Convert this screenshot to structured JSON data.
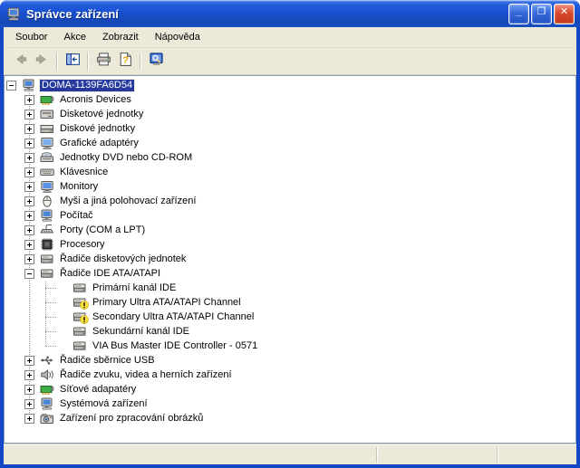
{
  "window": {
    "title": "Správce zařízení",
    "icon": "device-manager-computer-icon",
    "controls": [
      {
        "name": "minimize",
        "glyph": "_"
      },
      {
        "name": "maximize",
        "glyph": "❐"
      },
      {
        "name": "close",
        "glyph": "✕"
      }
    ]
  },
  "menu_bar": {
    "items": [
      {
        "label": "Soubor"
      },
      {
        "label": "Akce"
      },
      {
        "label": "Zobrazit"
      },
      {
        "label": "Nápověda"
      }
    ]
  },
  "toolbar": {
    "buttons": [
      {
        "name": "back",
        "icon": "arrow-left-icon",
        "disabled": true
      },
      {
        "name": "forward",
        "icon": "arrow-right-icon",
        "disabled": true
      },
      {
        "sep": true
      },
      {
        "name": "show-hide-console-tree",
        "icon": "console-tree-icon",
        "disabled": false
      },
      {
        "sep": true
      },
      {
        "name": "print",
        "icon": "printer-icon",
        "disabled": false
      },
      {
        "name": "help",
        "icon": "help-page-icon",
        "disabled": false
      },
      {
        "sep": true
      },
      {
        "name": "scan-for-hardware-changes",
        "icon": "scan-hardware-icon",
        "disabled": false
      }
    ]
  },
  "tree": {
    "items": [
      {
        "label": "DOMA-1139FA6D54",
        "level": 0,
        "expand": "minus",
        "icon": "computer",
        "selected": true,
        "warning": false
      },
      {
        "label": "Acronis Devices",
        "level": 1,
        "expand": "plus",
        "icon": "network-adapter",
        "selected": false,
        "warning": false
      },
      {
        "label": "Disketové jednotky",
        "level": 1,
        "expand": "plus",
        "icon": "floppy-drive",
        "selected": false,
        "warning": false
      },
      {
        "label": "Diskové jednotky",
        "level": 1,
        "expand": "plus",
        "icon": "disk-drive",
        "selected": false,
        "warning": false
      },
      {
        "label": "Grafické adaptéry",
        "level": 1,
        "expand": "plus",
        "icon": "display-adapter",
        "selected": false,
        "warning": false
      },
      {
        "label": "Jednotky DVD nebo CD-ROM",
        "level": 1,
        "expand": "plus",
        "icon": "cd-drive",
        "selected": false,
        "warning": false
      },
      {
        "label": "Klávesnice",
        "level": 1,
        "expand": "plus",
        "icon": "keyboard",
        "selected": false,
        "warning": false
      },
      {
        "label": "Monitory",
        "level": 1,
        "expand": "plus",
        "icon": "monitor",
        "selected": false,
        "warning": false
      },
      {
        "label": "Myši a jiná polohovací zařízení",
        "level": 1,
        "expand": "plus",
        "icon": "mouse",
        "selected": false,
        "warning": false
      },
      {
        "label": "Počítač",
        "level": 1,
        "expand": "plus",
        "icon": "computer",
        "selected": false,
        "warning": false
      },
      {
        "label": "Porty (COM a LPT)",
        "level": 1,
        "expand": "plus",
        "icon": "port",
        "selected": false,
        "warning": false
      },
      {
        "label": "Procesory",
        "level": 1,
        "expand": "plus",
        "icon": "processor",
        "selected": false,
        "warning": false
      },
      {
        "label": "Řadiče disketových jednotek",
        "level": 1,
        "expand": "plus",
        "icon": "controller",
        "selected": false,
        "warning": false
      },
      {
        "label": "Řadiče IDE ATA/ATAPI",
        "level": 1,
        "expand": "minus",
        "icon": "controller",
        "selected": false,
        "warning": false
      },
      {
        "label": "Primární kanál IDE",
        "level": 2,
        "expand": "none",
        "icon": "controller",
        "selected": false,
        "warning": false
      },
      {
        "label": "Primary Ultra ATA/ATAPI Channel",
        "level": 2,
        "expand": "none",
        "icon": "controller",
        "selected": false,
        "warning": true
      },
      {
        "label": "Secondary Ultra ATA/ATAPI Channel",
        "level": 2,
        "expand": "none",
        "icon": "controller",
        "selected": false,
        "warning": true
      },
      {
        "label": "Sekundární kanál IDE",
        "level": 2,
        "expand": "none",
        "icon": "controller",
        "selected": false,
        "warning": false
      },
      {
        "label": "VIA Bus Master IDE Controller - 0571",
        "level": 2,
        "expand": "none",
        "icon": "controller",
        "selected": false,
        "warning": false
      },
      {
        "label": "Řadiče sběrnice USB",
        "level": 1,
        "expand": "plus",
        "icon": "usb",
        "selected": false,
        "warning": false
      },
      {
        "label": "Řadiče zvuku, videa a herních zařízení",
        "level": 1,
        "expand": "plus",
        "icon": "sound",
        "selected": false,
        "warning": false
      },
      {
        "label": "Síťové adapatéry",
        "level": 1,
        "expand": "plus",
        "icon": "network-adapter",
        "selected": false,
        "warning": false
      },
      {
        "label": "Systémová zařízení",
        "level": 1,
        "expand": "plus",
        "icon": "system",
        "selected": false,
        "warning": false
      },
      {
        "label": "Zařízení pro zpracování obrázků",
        "level": 1,
        "expand": "plus",
        "icon": "imaging",
        "selected": false,
        "warning": false
      }
    ]
  },
  "status_bar": {
    "text": ""
  },
  "colors": {
    "titlebar_blue": "#1a52d2",
    "window_border_blue": "#1447c5",
    "chrome_beige": "#ece9d8",
    "selection_blue": "#263a9e",
    "warning_yellow": "#ffe13e",
    "close_button_red": "#d9492c",
    "tree_background": "#ffffff"
  }
}
